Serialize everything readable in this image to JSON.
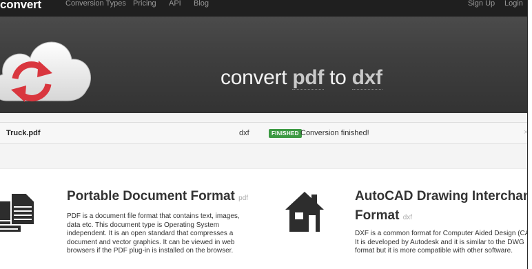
{
  "nav": {
    "logo": "convert",
    "links": [
      "Conversion Types",
      "Pricing",
      "API",
      "Blog"
    ],
    "signup": "Sign Up",
    "login": "Login"
  },
  "hero": {
    "prefix": "convert",
    "from": "pdf",
    "middle": "to",
    "to": "dxf"
  },
  "file": {
    "name": "Truck.pdf",
    "format": "dxf",
    "badge": "FINISHED",
    "status": "Conversion finished!",
    "close": "×"
  },
  "formats": [
    {
      "title": "Portable Document Format",
      "ext": "pdf",
      "lines": [
        "PDF is a document file format that contains text, images,",
        "data etc. This document type is Operating System",
        "independent. It is an open standard that compresses a",
        "document and vector graphics. It can be viewed in web",
        "browsers if the PDF plug-in is installed on the browser."
      ]
    },
    {
      "title_line1": "AutoCAD Drawing Interchange",
      "title_line2": "Format",
      "ext": "dxf",
      "lines": [
        "DXF is a common format for Computer Aided Design (CAD).",
        "It is developed by Autodesk and it is similar to the DWG",
        "format but it is more compatible with other software."
      ]
    }
  ],
  "colors": {
    "nav_bg": "#1f1f1f",
    "hero_bg": "#404040",
    "badge": "#3d9a43",
    "cloud_arrows": "#d9363e"
  },
  "icons": {
    "cloud": "cloud-sync-icon",
    "pdf": "documents-icon",
    "dxf": "house-icon"
  }
}
